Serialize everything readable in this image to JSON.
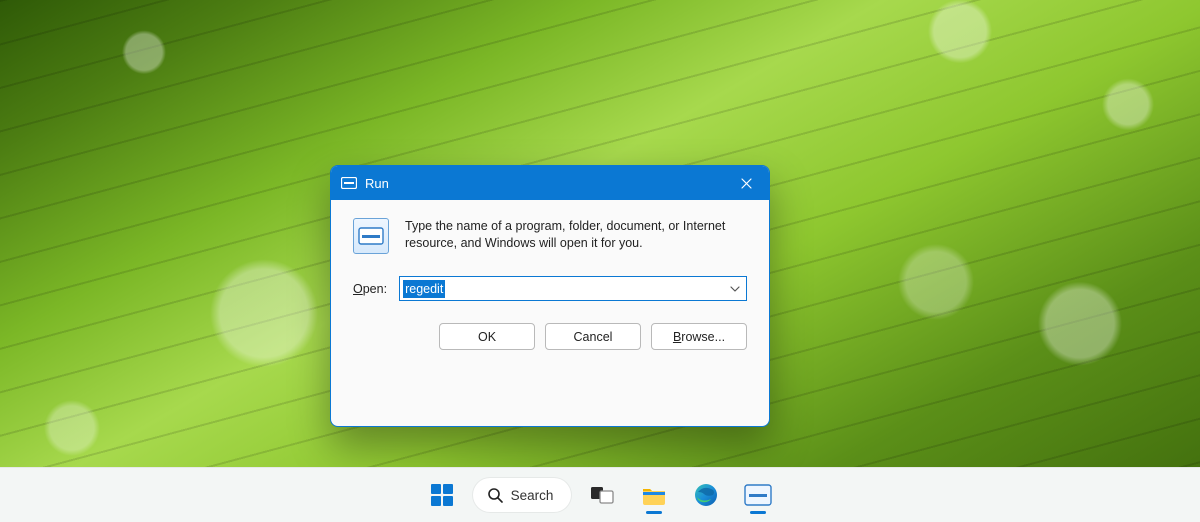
{
  "run_dialog": {
    "title": "Run",
    "description": "Type the name of a program, folder, document, or Internet resource, and Windows will open it for you.",
    "open_label_underline": "O",
    "open_label_rest": "pen:",
    "input_value": "regedit",
    "buttons": {
      "ok": "OK",
      "cancel": "Cancel",
      "browse_underline": "B",
      "browse_rest": "rowse..."
    }
  },
  "taskbar": {
    "search_label": "Search"
  }
}
